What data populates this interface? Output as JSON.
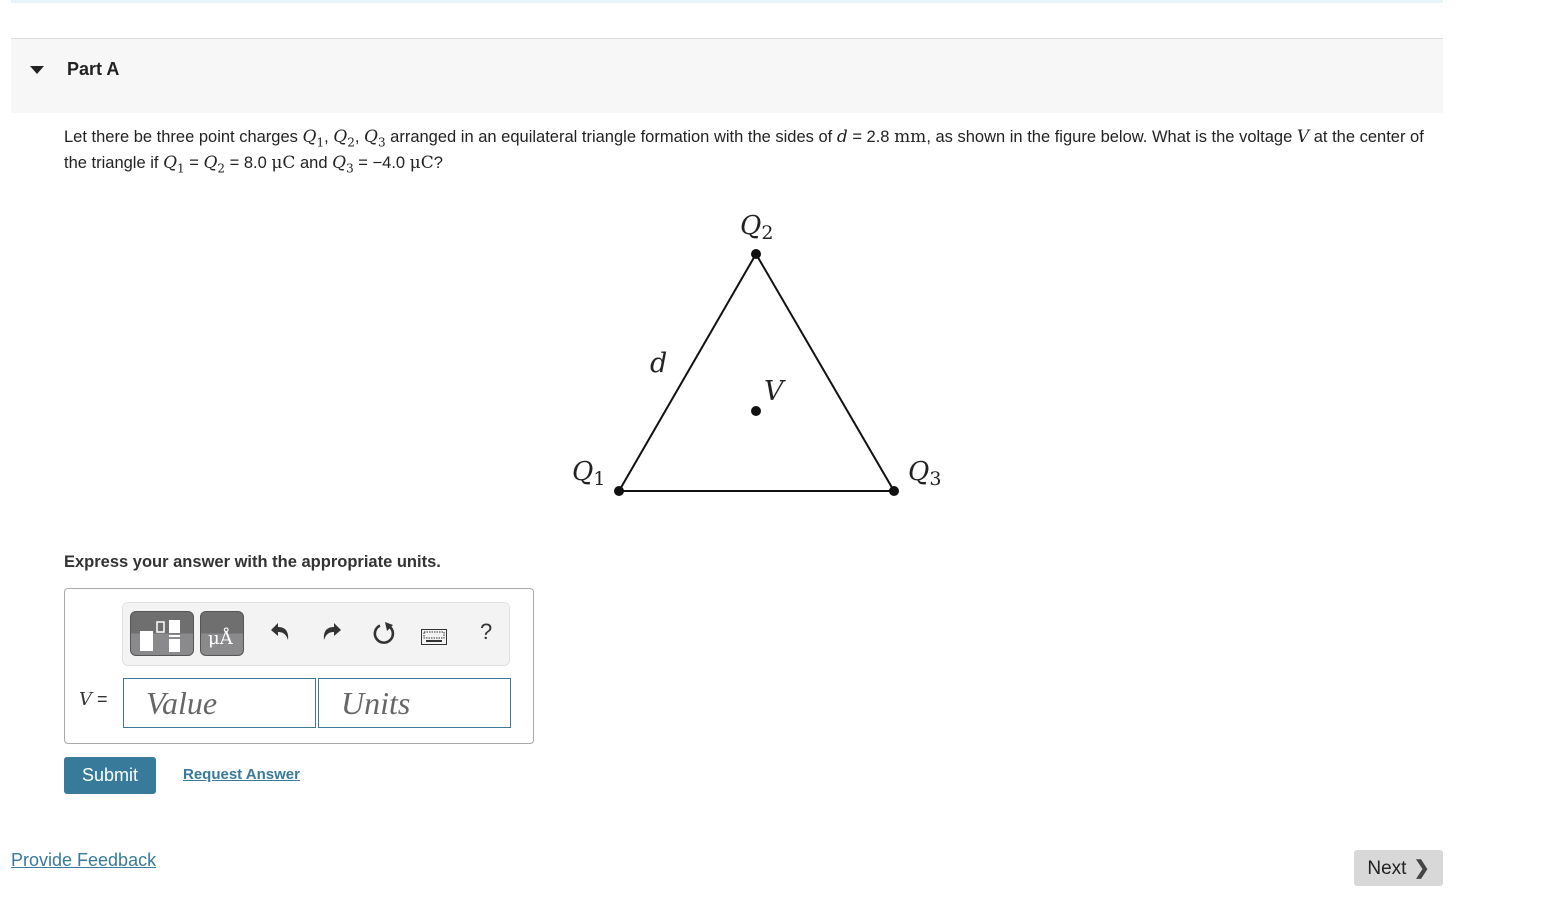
{
  "part": {
    "title": "Part A",
    "expanded": true
  },
  "question": {
    "t1": "Let there be three point charges ",
    "q1": "Q",
    "q1_sub": "1",
    "sep1": ", ",
    "q2": "Q",
    "q2_sub": "2",
    "sep2": ", ",
    "q3": "Q",
    "q3_sub": "3",
    "t2": " arranged in an equilateral triangle formation with the sides of ",
    "d_var": "d",
    "t3": " = 2.8 ",
    "d_unit": "mm",
    "t4": ", as shown in the figure below. What is the voltage ",
    "v_var": "V",
    "t5": " at the center of the triangle if ",
    "eq_q1": "Q",
    "eq_q1_sub": "1",
    "t6": " = ",
    "eq_q2": "Q",
    "eq_q2_sub": "2",
    "t7": " = 8.0 ",
    "unit1": "μC",
    "t8": " and ",
    "eq_q3": "Q",
    "eq_q3_sub": "3",
    "t9": " = −4.0 ",
    "unit2": "μC",
    "t10": "?"
  },
  "figure": {
    "label_q1": "Q",
    "label_q1_sub": "1",
    "label_q2": "Q",
    "label_q2_sub": "2",
    "label_q3": "Q",
    "label_q3_sub": "3",
    "label_d": "d",
    "label_v": "V"
  },
  "instructions": "Express your answer with the appropriate units.",
  "toolbar": {
    "templates_icon": "templates-icon",
    "units_icon_label": "μÅ",
    "undo_icon": "undo-icon",
    "redo_icon": "redo-icon",
    "reset_icon": "reset-icon",
    "keyboard_icon": "keyboard-icon",
    "help_label": "?"
  },
  "answer": {
    "variable": "V",
    "equals": " =",
    "value_placeholder": "Value",
    "value": "",
    "units_placeholder": "Units",
    "units": ""
  },
  "actions": {
    "submit": "Submit",
    "request_answer": "Request Answer"
  },
  "footer": {
    "feedback": "Provide Feedback",
    "next": "Next",
    "next_chevron": "❯"
  },
  "colors": {
    "accent": "#377a9a",
    "header_bg": "#f7f7f7",
    "next_bg": "#d8d8d8"
  }
}
